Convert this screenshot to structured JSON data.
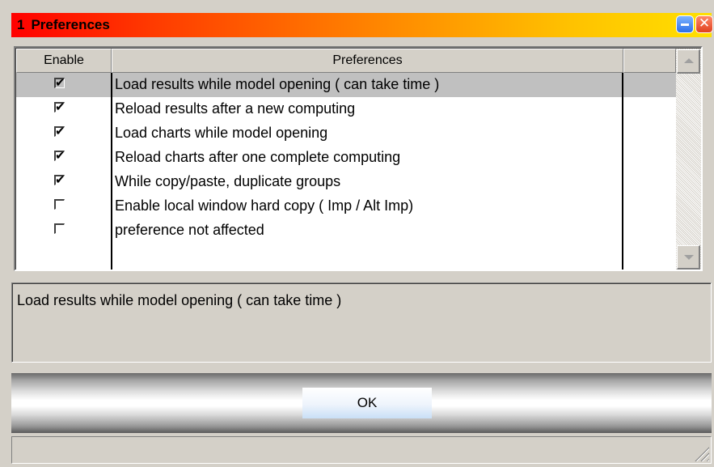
{
  "window": {
    "number": "1",
    "title": "Preferences",
    "minimize_icon": "minimize-icon",
    "close_icon": "close-icon"
  },
  "grid": {
    "columns": [
      "Enable",
      "Preferences",
      ""
    ],
    "rows": [
      {
        "enabled": true,
        "label": "Load results while model opening ( can take time )",
        "selected": true
      },
      {
        "enabled": true,
        "label": "Reload results after a new computing",
        "selected": false
      },
      {
        "enabled": true,
        "label": "Load charts while model opening",
        "selected": false
      },
      {
        "enabled": true,
        "label": "Reload charts after one complete computing",
        "selected": false
      },
      {
        "enabled": true,
        "label": "While copy/paste, duplicate groups",
        "selected": false
      },
      {
        "enabled": false,
        "label": "Enable local window hard copy ( Imp / Alt Imp)",
        "selected": false
      },
      {
        "enabled": false,
        "label": "preference not affected",
        "selected": false
      }
    ],
    "check_mark": "✔"
  },
  "description": {
    "text": "Load results while model opening ( can take time )"
  },
  "buttons": {
    "ok_label": "OK"
  },
  "colors": {
    "title_gradient_start": "#ff0000",
    "title_gradient_end": "#ffe000",
    "selected_row": "#c0c0c0",
    "dialog_bg": "#d4d0c8"
  }
}
